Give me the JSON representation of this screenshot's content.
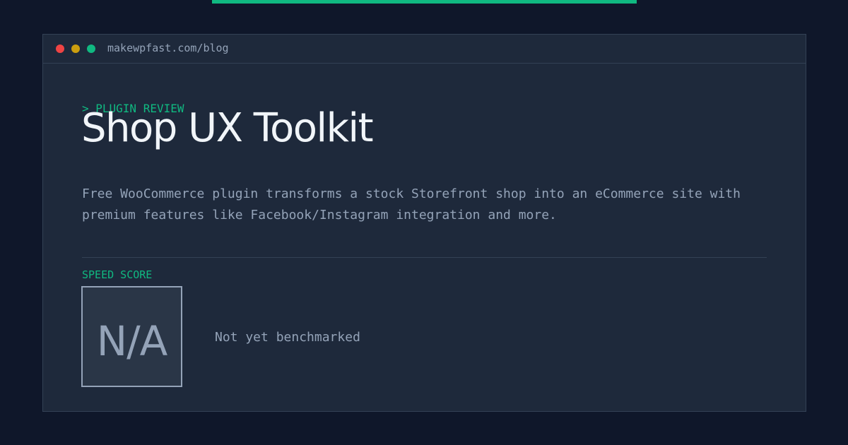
{
  "colors": {
    "background": "#0f172a",
    "card": "#1e293b",
    "accent": "#10b981",
    "text_primary": "#f1f5f9",
    "text_muted": "#94a3b8",
    "border": "#334155"
  },
  "window": {
    "url": "makewpfast.com/blog"
  },
  "post": {
    "kicker": "> PLUGIN REVIEW",
    "title": "Shop UX Toolkit",
    "description": "Free WooCommerce plugin transforms a stock Storefront shop into an eCommerce site with premium features like Facebook/Instagram integration and more."
  },
  "speed": {
    "label": "SPEED SCORE",
    "value": "N/A",
    "status": "Not yet benchmarked"
  }
}
